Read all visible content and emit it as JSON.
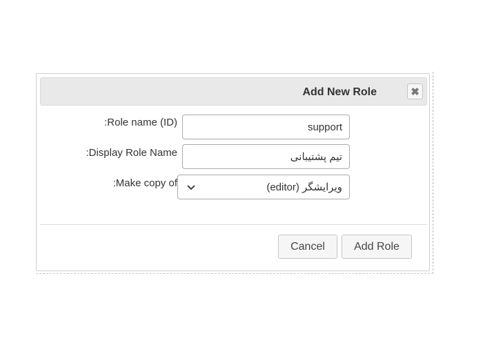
{
  "dialog": {
    "title": "Add New Role",
    "close_icon": "close-x-icon",
    "fields": {
      "role_name": {
        "label": ":Role name (ID)",
        "value": "support"
      },
      "display_name": {
        "label": ":Display Role Name",
        "value": "تیم پشتیبانی"
      },
      "make_copy": {
        "label": ":Make copy of",
        "selected": "ویرایشگر (editor)",
        "icon": "chevron-down-icon"
      }
    },
    "buttons": {
      "cancel": "Cancel",
      "add_role": "Add Role"
    }
  }
}
